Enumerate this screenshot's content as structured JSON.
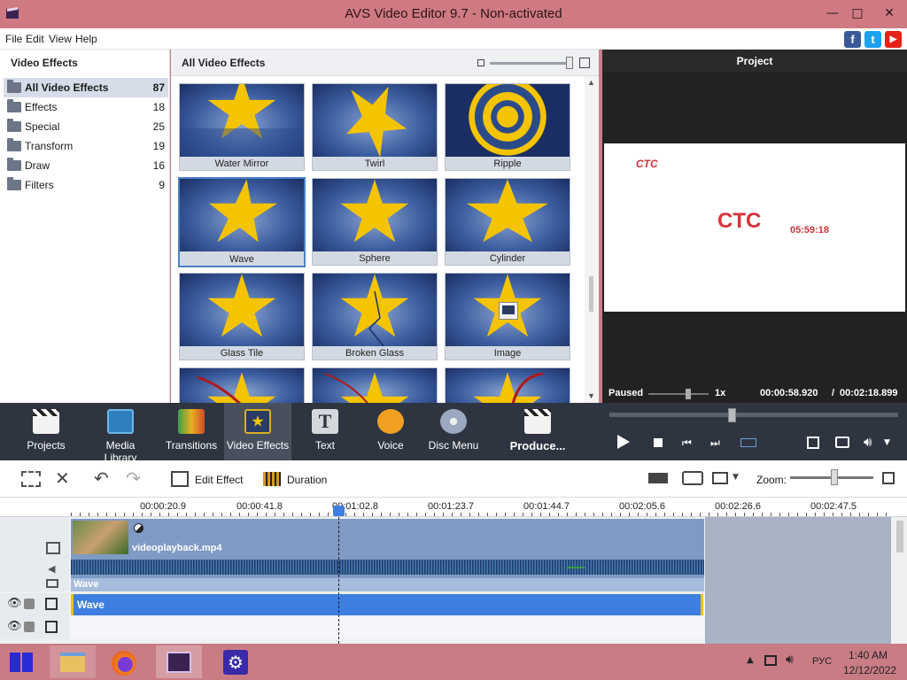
{
  "window": {
    "title": "AVS Video Editor 9.7 - Non-activated"
  },
  "menu": [
    "File",
    "Edit",
    "View",
    "Help"
  ],
  "social": [
    {
      "name": "facebook-icon",
      "glyph": "f",
      "color": "#3b5998"
    },
    {
      "name": "twitter-icon",
      "glyph": "t",
      "color": "#1da1f2"
    },
    {
      "name": "youtube-icon",
      "glyph": "▶",
      "color": "#e62117"
    }
  ],
  "left_panel": {
    "title": "Video Effects",
    "categories": [
      {
        "label": "All Video Effects",
        "count": "87"
      },
      {
        "label": "Effects",
        "count": "18"
      },
      {
        "label": "Special",
        "count": "25"
      },
      {
        "label": "Transform",
        "count": "19"
      },
      {
        "label": "Draw",
        "count": "16"
      },
      {
        "label": "Filters",
        "count": "9"
      }
    ]
  },
  "grid": {
    "title": "All Video Effects",
    "tiles": [
      "Water Mirror",
      "Twirl",
      "Ripple",
      "Wave",
      "Sphere",
      "Cylinder",
      "Glass Tile",
      "Broken Glass",
      "Image"
    ]
  },
  "preview": {
    "title": "Project",
    "logo_small": "CTC",
    "logo_big": "CTC",
    "clock": "05:59:18",
    "status": "Paused",
    "speed": "1x",
    "time_current": "00:00:58.920",
    "time_sep": "/",
    "time_total": "00:02:18.899"
  },
  "toolbar": {
    "items": [
      "Projects",
      "Media Library",
      "Transitions",
      "Video Effects",
      "Text",
      "Voice",
      "Disc Menu"
    ],
    "produce": "Produce..."
  },
  "timeline_toolbar": {
    "edit_effect": "Edit Effect",
    "duration": "Duration",
    "zoom": "Zoom:"
  },
  "ruler": [
    "00:00:20.9",
    "00:00:41.8",
    "00:01:02.8",
    "00:01:23.7",
    "00:01:44.7",
    "00:02:05.6",
    "00:02:26.6",
    "00:02:47.5"
  ],
  "tracks": {
    "clip_name": "videoplayback.mp4",
    "effect_label": "Wave",
    "effect_track_label": "Wave"
  },
  "taskbar": {
    "lang": "РУС",
    "time": "1:40 AM",
    "date": "12/12/2022"
  },
  "colors": {
    "accent": "#3d7ee0",
    "dark_toolbar": "#2e3541",
    "titlebar": "#cf7a82",
    "star": "#f4c400"
  }
}
